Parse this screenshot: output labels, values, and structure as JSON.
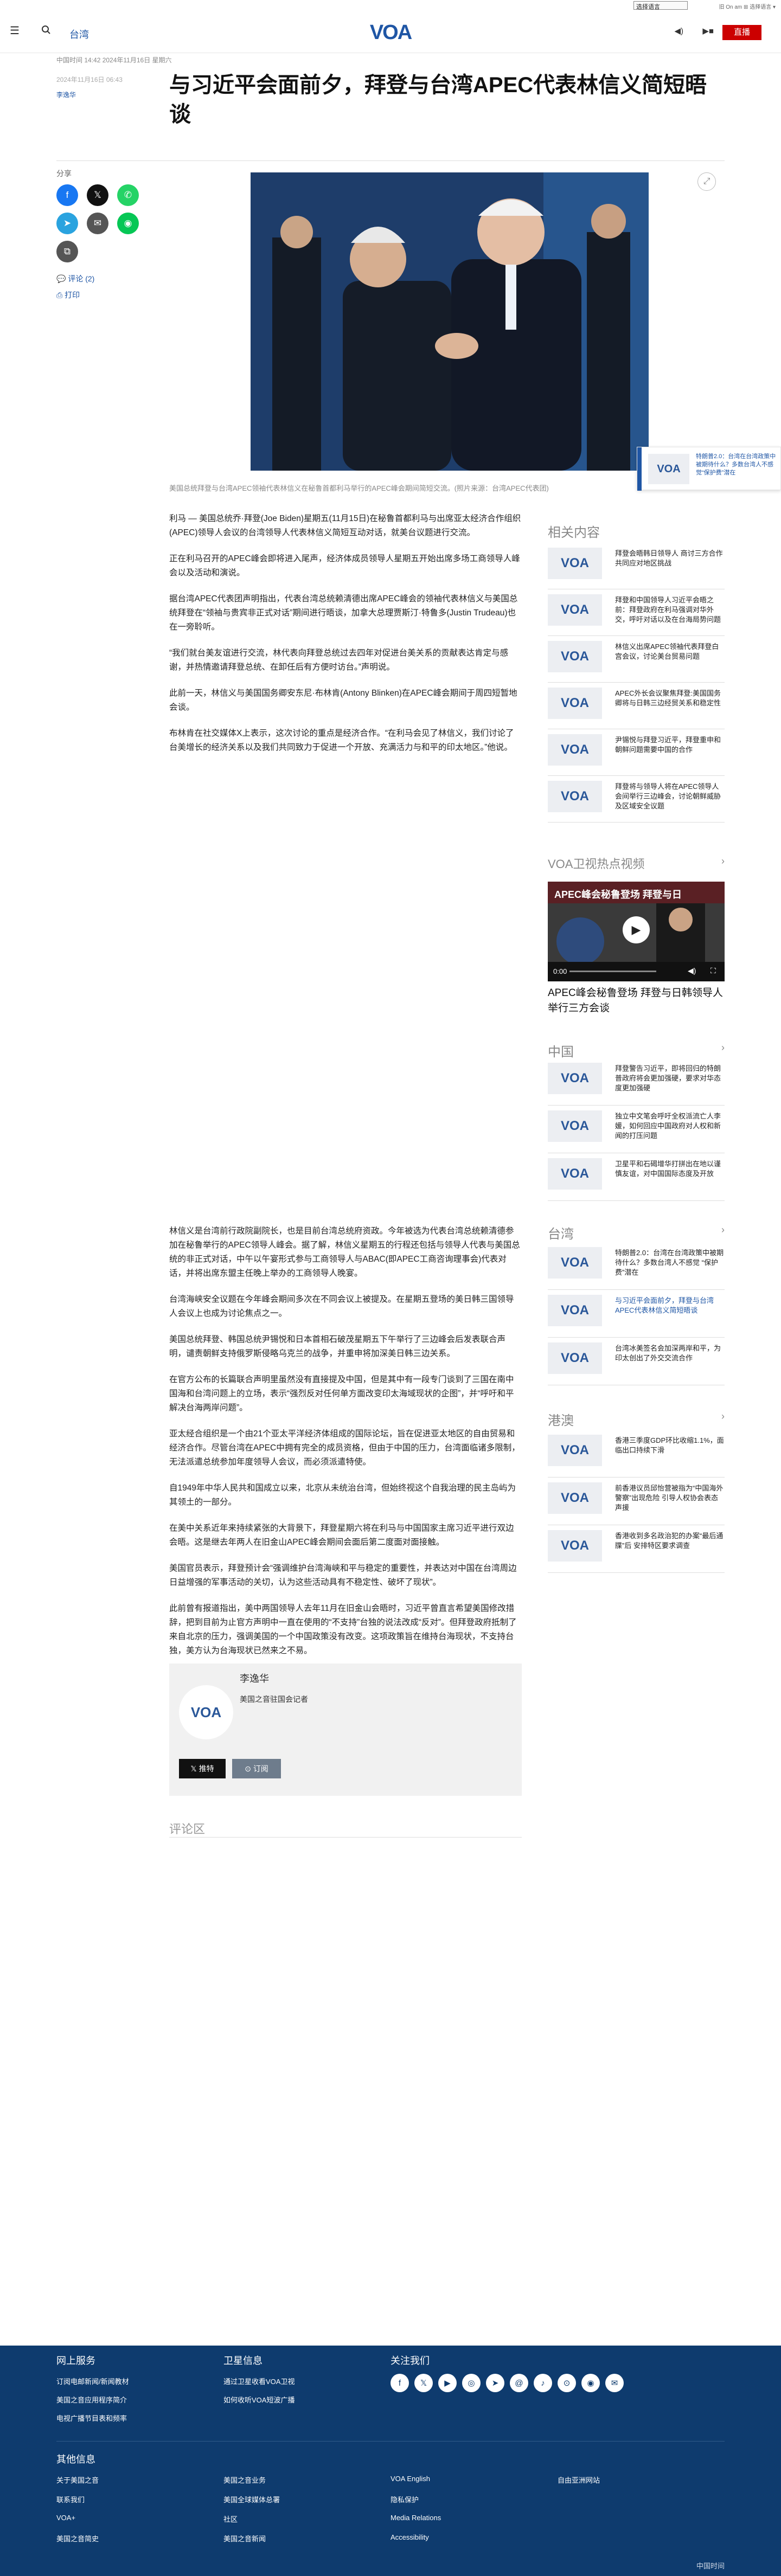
{
  "topbar": {
    "language_select": "选择语言",
    "toplinks": "旧 On am ⊞ 选择语言 ▾"
  },
  "header": {
    "section": "台湾",
    "live_button": "直播",
    "logo_text": "VOA"
  },
  "meta": {
    "timestamp_line": "中国时间 14:42 2024年11月16日 星期六",
    "dateline": "2024年11月16日 06:43",
    "author": "李逸华"
  },
  "article": {
    "title": "与习近平会面前夕，拜登与台湾APEC代表林信义简短晤谈",
    "caption": "美国总统拜登与台湾APEC领袖代表林信义在秘鲁首都利马举行的APEC峰会期间简短交流。(照片来源：台湾APEC代表团)",
    "paragraphs_part1": [
      "利马 — 美国总统乔·拜登(Joe Biden)星期五(11月15日)在秘鲁首都利马与出席亚太经济合作组织(APEC)领导人会议的台湾领导人代表林信义简短互动对话，就美台议题进行交流。",
      "正在利马召开的APEC峰会即将进入尾声，经济体成员领导人星期五开始出席多场工商领导人峰会以及活动和演说。",
      "据台湾APEC代表团声明指出，代表台湾总统赖清德出席APEC峰会的领袖代表林信义与美国总统拜登在“领袖与贵宾非正式对话”期间进行晤谈，加拿大总理贾斯汀·特鲁多(Justin Trudeau)也在一旁聆听。",
      "“我们就台美友谊进行交流，林代表向拜登总统过去四年对促进台美关系的贡献表达肯定与感谢，并热情邀请拜登总统、在卸任后有方便时访台。”声明说。",
      "此前一天，林信义与美国国务卿安东尼·布林肯(Antony Blinken)在APEC峰会期间于周四短暂地会谈。",
      "布林肯在社交媒体X上表示，这次讨论的重点是经济合作。“在利马会见了林信义，我们讨论了台美增长的经济关系以及我们共同致力于促进一个开放、充满活力与和平的印太地区。”他说。"
    ],
    "paragraphs_part2": [
      "林信义是台湾前行政院副院长，也是目前台湾总统府资政。今年被选为代表台湾总统赖清德参加在秘鲁举行的APEC领导人峰会。据了解，林信义星期五的行程还包括与领导人代表与美国总统的非正式对话，中午以午宴形式参与工商领导人与ABAC(即APEC工商咨询理事会)代表对话，并将出席东盟主任晚上举办的工商领导人晚宴。",
      "台湾海峡安全议题在今年峰会期间多次在不同会议上被提及。在星期五登场的美日韩三国领导人会议上也成为讨论焦点之一。",
      "美国总统拜登、韩国总统尹锡悦和日本首相石破茂星期五下午举行了三边峰会后发表联合声明，谴责朝鲜支持俄罗斯侵略乌克兰的战争，并重申将加深美日韩三边关系。",
      "在官方公布的长篇联合声明里虽然没有直接提及中国，但是其中有一段专门谈到了三国在南中国海和台湾问题上的立场，表示“强烈反对任何单方面改变印太海域现状的企图”，并“呼吁和平解决台海两岸问题”。",
      "亚太经合组织是一个由21个亚太平洋经济体组成的国际论坛，旨在促进亚太地区的自由贸易和经济合作。尽管台湾在APEC中拥有完全的成员资格，但由于中国的压力，台湾面临诸多限制，无法派遣总统参加年度领导人会议，而必须派遣特使。",
      "自1949年中华人民共和国成立以来，北京从未统治台湾，但始终视这个自我治理的民主岛屿为其领土的一部分。",
      "在美中关系近年来持续紧张的大背景下，拜登星期六将在利马与中国国家主席习近平进行双边会晤。这是继去年两人在旧金山APEC峰会期间会面后第二度面对面接触。",
      "美国官员表示，拜登预计会“强调维护台湾海峡和平与稳定的重要性，并表达对中国在台湾周边日益增强的军事活动的关切，认为这些活动具有不稳定性、破坏了现状”。",
      "此前曾有报道指出，美中两国领导人去年11月在旧金山会晤时，习近平曾直言希望美国修改措辞，把到目前为止官方声明中一直在使用的“不支持”台独的说法改成“反对”。但拜登政府抵制了来自北京的压力，强调美国的一个中国政策没有改变。这项政策旨在维持台海现状，不支持台独，美方认为台海现状已然来之不易。"
    ]
  },
  "share": {
    "label": "分享",
    "comments_link": "评论 (2)",
    "print_link": "打印"
  },
  "sidebar": {
    "related_heading": "相关内容",
    "related": [
      "拜登会晤韩日领导人 商讨三方合作 共同应对地区挑战",
      "拜登和中国领导人习近平会晤之前：拜登政府在利马强调对华外交，呼吁对话以及在台海局势问题",
      "林信义出席APEC领袖代表拜登白宫会议，讨论美台贸易问题",
      "APEC外长会议聚焦拜登:美国国务卿将与日韩三边经贸关系和稳定性",
      "尹锡悦与拜登习近平，拜登重申和朝鲜问题需要中国的合作",
      "拜登将与领导人将在APEC领导人会间举行三边峰会，讨论朝鲜威胁及区域安全议题"
    ],
    "video_heading": "VOA卫视热点视频",
    "video_overlay_title": "APEC峰会秘鲁登场 拜登与日",
    "video_time": "0:00",
    "video_title": "APEC峰会秘鲁登场 拜登与日韩领导人举行三方会谈",
    "china_heading": "中国",
    "china_items": [
      "拜登警告习近平，即将回归的特朗普政府将会更加强硬，要求对华态度更加强硬",
      "独立中文笔会呼吁全权派流亡人李媛，如何回应中国政府对人权和新闻的打压问题",
      "卫星平和石碣增华打拼出在地以谨慎友谊，对中国国际态度及开放"
    ],
    "taiwan_heading": "台湾",
    "taiwan_items": [
      "特朗普2.0：台湾在台湾政策中被期待什么？多数台湾人不感觉 “保护费”潜在",
      "与习近平会面前夕，拜登与台湾APEC代表林信义简短晤谈",
      "台湾冰美签名会加深两岸和平，为印太创出了外交交流合作"
    ],
    "hk_heading": "港澳",
    "hk_items": [
      "香港三季度GDP环比收缩1.1%，面临出口持续下滑",
      "前香港议员邱怡营被指为“中国海外警察”出现危险 引导人权协会表态声援",
      "香港收到多名政治犯的办案“最后通牒”后 安排特区要求调查"
    ]
  },
  "overlay": {
    "card_text": "特朗普2.0：台湾在台湾政策中被期待什么？多数台湾人不感觉“保护费”潜在"
  },
  "bio": {
    "name": "李逸华",
    "role": "美国之音驻国会记者",
    "follow_x": "推特",
    "subscribe": "订阅"
  },
  "comments": {
    "heading": "评论区"
  },
  "footer": {
    "col1_heading": "网上服务",
    "col1_links": [
      "订阅电邮新闻/新闻教材",
      "美国之音应用程序简介",
      "电视广播节目表和频率"
    ],
    "col2_heading": "卫星信息",
    "col2_links": [
      "通过卫星收看VOA卫视",
      "如何收听VOA短波广播"
    ],
    "col3_heading": "关注我们",
    "social_icons": [
      "facebook-icon",
      "x-icon",
      "youtube-icon",
      "instagram-icon",
      "telegram-icon",
      "threads-icon",
      "podcast-icon",
      "rss-icon",
      "line-icon",
      "email-icon"
    ],
    "other_heading": "其他信息",
    "other_links": [
      [
        "关于美国之音",
        "美国之音业务",
        "VOA English",
        "自由亚洲网站"
      ],
      [
        "联系我们",
        "美国全球媒体总署",
        "隐私保护",
        ""
      ],
      [
        "VOA+",
        "社区",
        "Media Relations",
        ""
      ],
      [
        "美国之音简史",
        "美国之音新闻",
        "Accessibility",
        ""
      ]
    ],
    "bottom_right": "中国时间"
  },
  "colors": {
    "brand_blue": "#1f56a5",
    "footer_bg": "#0e3b6e",
    "live_red": "#cc0000"
  }
}
